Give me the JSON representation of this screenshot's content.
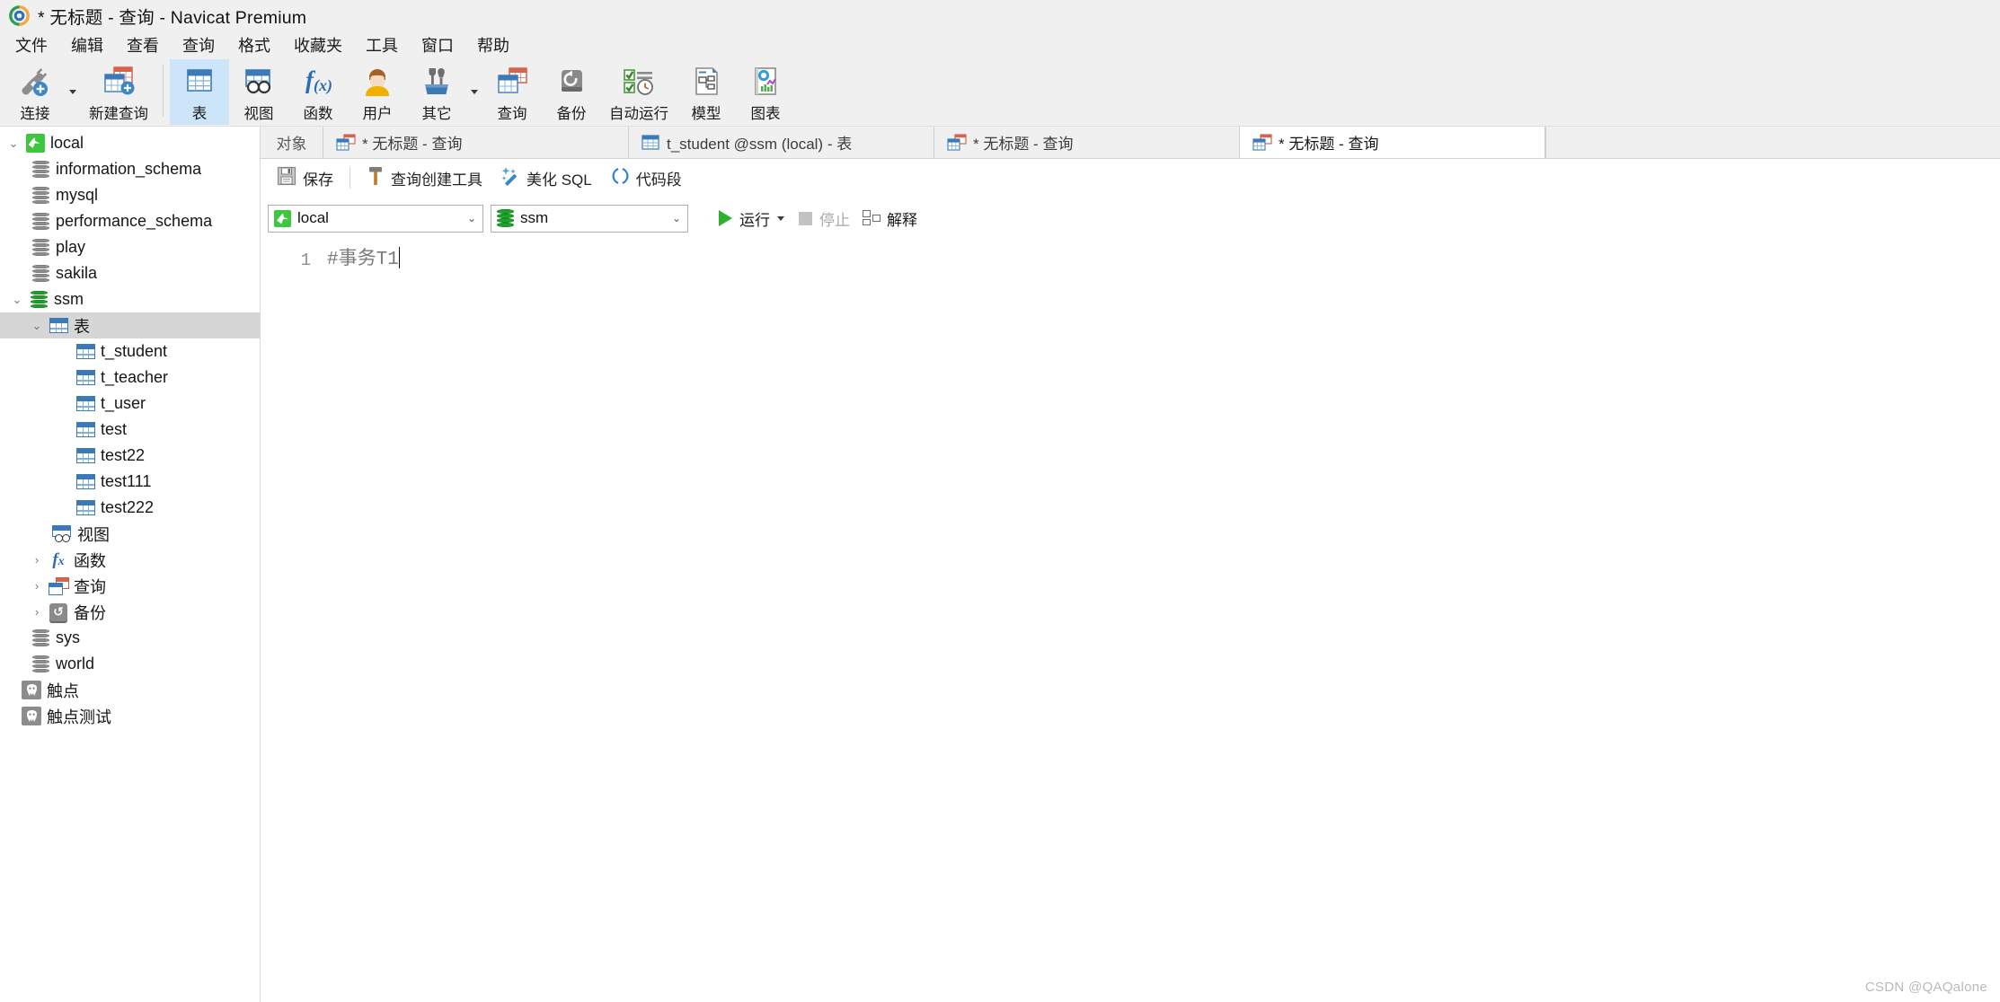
{
  "window": {
    "title": "* 无标题 - 查询 - Navicat Premium",
    "logo_icon": "navicat-logo-icon"
  },
  "menubar": {
    "items": [
      {
        "label": "文件",
        "name": "menu-file"
      },
      {
        "label": "编辑",
        "name": "menu-edit"
      },
      {
        "label": "查看",
        "name": "menu-view"
      },
      {
        "label": "查询",
        "name": "menu-query"
      },
      {
        "label": "格式",
        "name": "menu-format"
      },
      {
        "label": "收藏夹",
        "name": "menu-favorites"
      },
      {
        "label": "工具",
        "name": "menu-tools"
      },
      {
        "label": "窗口",
        "name": "menu-window"
      },
      {
        "label": "帮助",
        "name": "menu-help"
      }
    ]
  },
  "toolbar": {
    "items": [
      {
        "label": "连接",
        "icon": "connection-plug-add-icon",
        "active": false
      },
      {
        "label": "新建查询",
        "icon": "new-query-table-add-icon",
        "active": false
      },
      {
        "label": "表",
        "icon": "table-icon",
        "active": true
      },
      {
        "label": "视图",
        "icon": "view-icon",
        "active": false
      },
      {
        "label": "函数",
        "icon": "function-fx-icon",
        "active": false
      },
      {
        "label": "用户",
        "icon": "user-icon",
        "active": false
      },
      {
        "label": "其它",
        "icon": "other-tools-icon",
        "active": false
      },
      {
        "label": "查询",
        "icon": "query-icon",
        "active": false
      },
      {
        "label": "备份",
        "icon": "backup-icon",
        "active": false
      },
      {
        "label": "自动运行",
        "icon": "automation-checklist-icon",
        "active": false
      },
      {
        "label": "模型",
        "icon": "model-diagram-icon",
        "active": false
      },
      {
        "label": "图表",
        "icon": "chart-report-icon",
        "active": false
      }
    ]
  },
  "sidebar": {
    "nodes": [
      {
        "label": "local",
        "icon": "mysql-connection-icon",
        "indent": 0,
        "twisty": "open",
        "selected": false
      },
      {
        "label": "information_schema",
        "icon": "database-icon",
        "indent": 1,
        "twisty": "none",
        "selected": false
      },
      {
        "label": "mysql",
        "icon": "database-icon",
        "indent": 1,
        "twisty": "none",
        "selected": false
      },
      {
        "label": "performance_schema",
        "icon": "database-icon",
        "indent": 1,
        "twisty": "none",
        "selected": false
      },
      {
        "label": "play",
        "icon": "database-icon",
        "indent": 1,
        "twisty": "none",
        "selected": false
      },
      {
        "label": "sakila",
        "icon": "database-icon",
        "indent": 1,
        "twisty": "none",
        "selected": false
      },
      {
        "label": "ssm",
        "icon": "database-active-icon",
        "indent": 1,
        "twisty": "open",
        "selected": false
      },
      {
        "label": "表",
        "icon": "table-icon",
        "indent": 2,
        "twisty": "open",
        "selected": true
      },
      {
        "label": "t_student",
        "icon": "table-icon",
        "indent": 3,
        "twisty": "none",
        "selected": false
      },
      {
        "label": "t_teacher",
        "icon": "table-icon",
        "indent": 3,
        "twisty": "none",
        "selected": false
      },
      {
        "label": "t_user",
        "icon": "table-icon",
        "indent": 3,
        "twisty": "none",
        "selected": false
      },
      {
        "label": "test",
        "icon": "table-icon",
        "indent": 3,
        "twisty": "none",
        "selected": false
      },
      {
        "label": "test22",
        "icon": "table-icon",
        "indent": 3,
        "twisty": "none",
        "selected": false
      },
      {
        "label": "test111",
        "icon": "table-icon",
        "indent": 3,
        "twisty": "none",
        "selected": false
      },
      {
        "label": "test222",
        "icon": "table-icon",
        "indent": 3,
        "twisty": "none",
        "selected": false
      },
      {
        "label": "视图",
        "icon": "view-icon",
        "indent": 2,
        "twisty": "none",
        "selected": false
      },
      {
        "label": "函数",
        "icon": "function-fx-icon",
        "indent": 2,
        "twisty": "closed",
        "selected": false
      },
      {
        "label": "查询",
        "icon": "query-icon",
        "indent": 2,
        "twisty": "closed",
        "selected": false
      },
      {
        "label": "备份",
        "icon": "backup-icon",
        "indent": 2,
        "twisty": "closed",
        "selected": false
      },
      {
        "label": "sys",
        "icon": "database-icon",
        "indent": 1,
        "twisty": "none",
        "selected": false
      },
      {
        "label": "world",
        "icon": "database-icon",
        "indent": 1,
        "twisty": "none",
        "selected": false
      },
      {
        "label": "触点",
        "icon": "postgres-connection-icon",
        "indent": 0,
        "twisty": "none",
        "selected": false
      },
      {
        "label": "触点测试",
        "icon": "postgres-connection-icon",
        "indent": 0,
        "twisty": "none",
        "selected": false
      }
    ]
  },
  "tabbar": {
    "object_tab_label": "对象",
    "tabs": [
      {
        "label": "* 无标题 - 查询",
        "icon": "query-icon",
        "active": false
      },
      {
        "label": "t_student @ssm (local) - 表",
        "icon": "table-icon",
        "active": false
      },
      {
        "label": "* 无标题 - 查询",
        "icon": "query-icon",
        "active": false
      },
      {
        "label": "* 无标题 - 查询",
        "icon": "query-icon",
        "active": true
      }
    ]
  },
  "query_toolbar": {
    "save": "保存",
    "query_builder": "查询创建工具",
    "beautify_sql": "美化 SQL",
    "code_snippet": "代码段"
  },
  "connection_bar": {
    "connection": "local",
    "database": "ssm",
    "run": "运行",
    "stop": "停止",
    "explain": "解释"
  },
  "editor": {
    "line_numbers": [
      "1"
    ],
    "lines": [
      "#事务T1"
    ]
  },
  "watermark": "CSDN @QAQalone",
  "colors": {
    "accent_blue": "#3b79b8",
    "active_tab_bg": "#cce5fa",
    "selection_gray": "#d6d6d6",
    "green_run": "#30b030",
    "chrome_bg": "#f0f0f0"
  }
}
